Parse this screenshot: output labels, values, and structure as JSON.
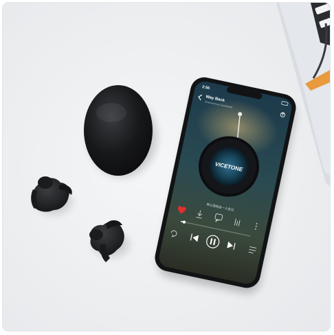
{
  "image": {
    "alt": "Black wireless earbuds with charging case next to a smartphone playing music"
  },
  "phone": {
    "status_time": "2:56",
    "track_title": "Way Back",
    "track_subtitle": "Vicetone/Cozi Zuehlsdorff",
    "album_text": "VICETONE",
    "lyric_line": "再让我独自一人走过",
    "progress_fraction": 0.05
  },
  "colors": {
    "background": "#eef0f2",
    "device_black": "#121315",
    "screen_top": "#1c2f3e",
    "screen_bottom": "#3a3f2b",
    "accent_red": "#e0302f",
    "laptop_silver": "#d6dbe0",
    "orange_accent": "#e89a3c"
  },
  "icons": {
    "back": "chevron-left-icon",
    "share": "share-icon",
    "like": "heart-icon",
    "download": "download-icon",
    "comment": "comment-icon",
    "more": "more-icon",
    "repeat": "repeat-icon",
    "previous": "previous-icon",
    "pause": "pause-icon",
    "next": "next-icon",
    "playlist": "playlist-icon"
  }
}
